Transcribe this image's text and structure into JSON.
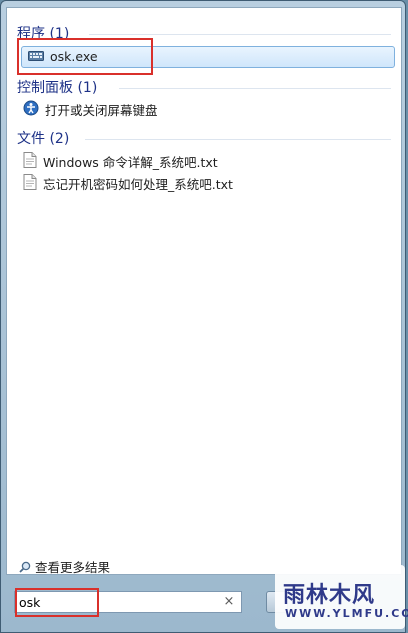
{
  "groups": [
    {
      "title": "程序 (1)",
      "items": [
        "osk.exe"
      ]
    },
    {
      "title": "控制面板 (1)",
      "items": [
        "打开或关闭屏幕键盘"
      ]
    },
    {
      "title": "文件 (2)",
      "items": [
        "Windows 命令详解_系统吧.txt",
        "忘记开机密码如何处理_系统吧.txt"
      ]
    }
  ],
  "see_more": "查看更多结果",
  "search": {
    "value": "osk",
    "clear": "×"
  },
  "watermark": {
    "main": "雨林木风",
    "sub": "WWW.YLMFU.COM"
  },
  "colors": {
    "group_header": "#1e3287",
    "highlight_border": "#d9302b",
    "selection": "#cfe6fb"
  }
}
